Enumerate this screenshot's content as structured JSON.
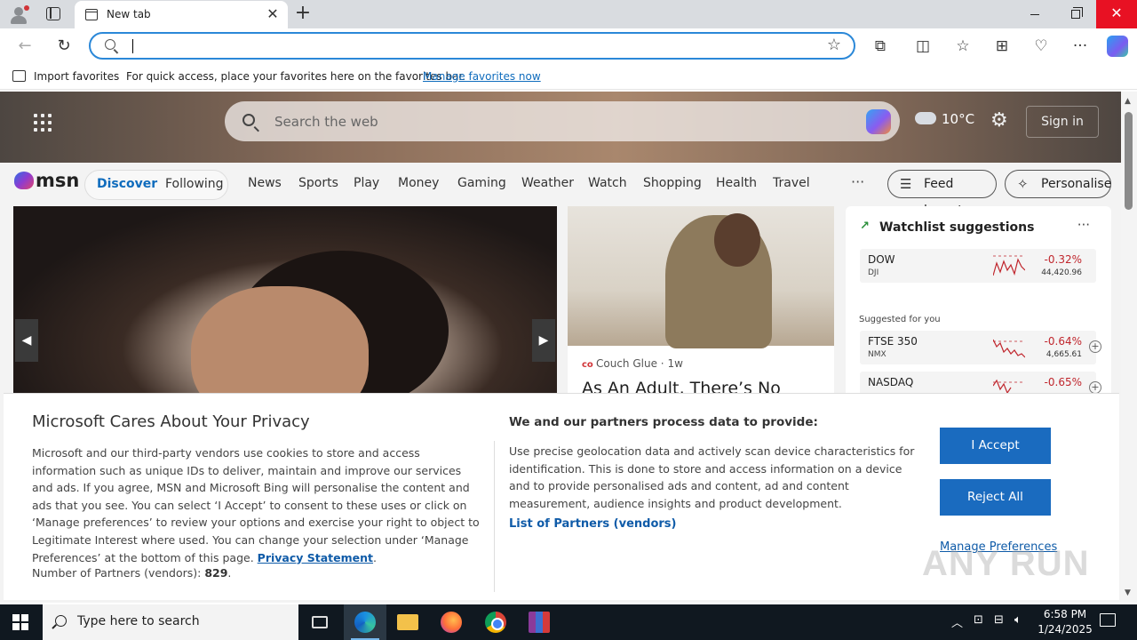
{
  "browser": {
    "tab_title": "New tab",
    "address_value": "",
    "favorites_bar": {
      "import_label": "Import favorites",
      "hint": "For quick access, place your favorites here on the favorites bar.",
      "manage_link": "Manage favorites now"
    }
  },
  "msn": {
    "search_placeholder": "Search the web",
    "weather_temp": "10°C",
    "signin_label": "Sign in",
    "logo_text": "msn",
    "tabs": {
      "discover": "Discover",
      "following": "Following"
    },
    "nav_items": [
      "News",
      "Sports",
      "Play",
      "Money",
      "Gaming",
      "Weather",
      "Watch",
      "Shopping",
      "Health",
      "Travel"
    ],
    "more_label": "···",
    "feed_layout_label": "Feed layout",
    "personalise_label": "Personalise",
    "card": {
      "source": "Couch Glue",
      "age": "1w",
      "source_separator": "·",
      "headline": "As An Adult, There’s No"
    },
    "watchlist": {
      "title": "Watchlist suggestions",
      "suggested_label": "Suggested for you",
      "stocks": [
        {
          "symbol": "DOW",
          "sub": "DJI",
          "change": "-0.32%",
          "value": "44,420.96"
        },
        {
          "symbol": "FTSE 350",
          "sub": "NMX",
          "change": "-0.64%",
          "value": "4,665.61"
        },
        {
          "symbol": "NASDAQ",
          "sub": "",
          "change": "-0.65%",
          "value": ""
        }
      ]
    }
  },
  "privacy": {
    "title": "Microsoft Cares About Your Privacy",
    "body": "Microsoft and our third-party vendors use cookies to store and access information such as unique IDs to deliver, maintain and improve our services and ads. If you agree, MSN and Microsoft Bing will personalise the content and ads that you see. You can select ‘I Accept’ to consent to these uses or click on ‘Manage preferences’ to review your options and exercise your right to object to Legitimate Interest where used.  You can change your selection under ‘Manage Preferences’ at the bottom of this page.",
    "privacy_link": "Privacy Statement",
    "partners_label": "Number of Partners (vendors):",
    "partners_count": "829",
    "purposes_title": "We and our partners process data to provide:",
    "purposes_body": "Use precise geolocation data and actively scan device characteristics for identification. This is done to store and access information on a device and to provide personalised ads and content, ad and content measurement, audience insights and product development.",
    "vendors_link": "List of Partners (vendors)",
    "accept_label": "I Accept",
    "reject_label": "Reject All",
    "manage_label": "Manage Preferences"
  },
  "watermark": "ANY RUN",
  "taskbar": {
    "search_placeholder": "Type here to search",
    "time": "6:58 PM",
    "date": "1/24/2025"
  },
  "colors": {
    "accent": "#1a6bbf",
    "link": "#0f5ba8",
    "address_border": "#2b88d8",
    "close_red": "#e81123",
    "negative": "#c0262d"
  }
}
